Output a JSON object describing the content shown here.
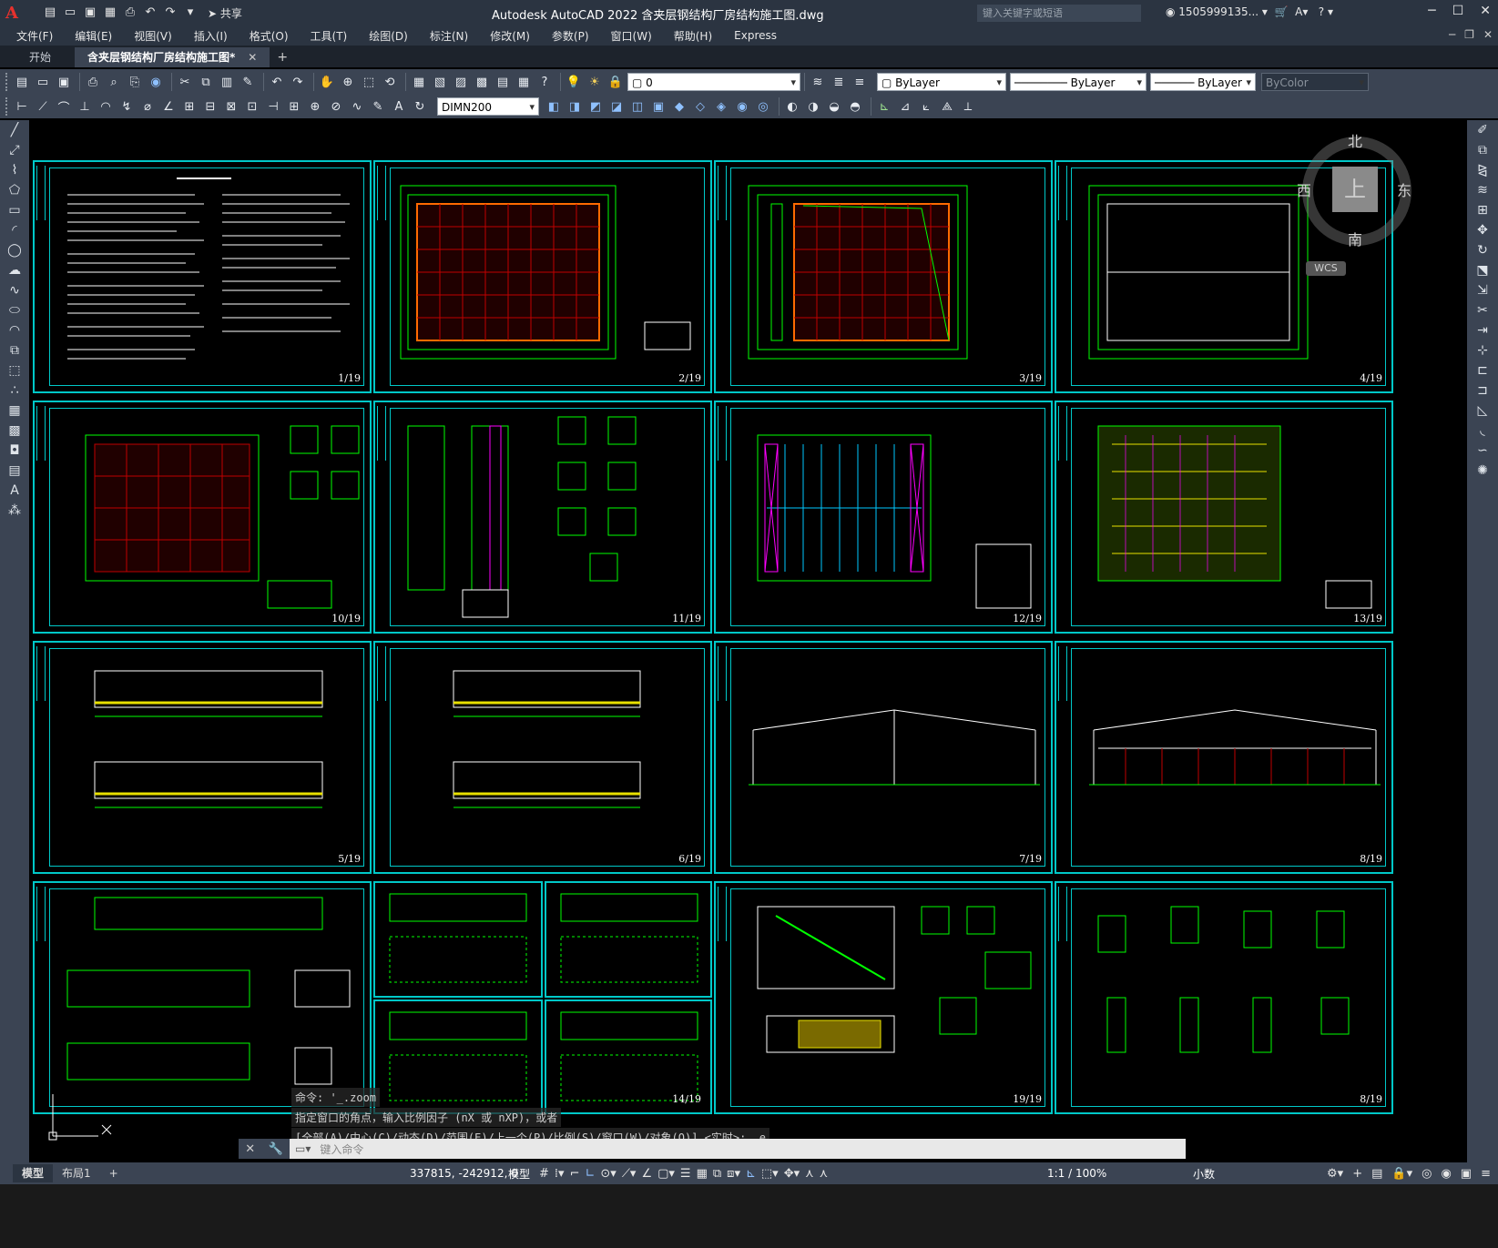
{
  "app": {
    "title": "Autodesk AutoCAD 2022    含夹层钢结构厂房结构施工图.dwg",
    "logo": "A",
    "share_label": "共享",
    "search_placeholder": "键入关键字或短语",
    "user": "1505999135..."
  },
  "menu": [
    "文件(F)",
    "编辑(E)",
    "视图(V)",
    "插入(I)",
    "格式(O)",
    "工具(T)",
    "绘图(D)",
    "标注(N)",
    "修改(M)",
    "参数(P)",
    "窗口(W)",
    "帮助(H)",
    "Express"
  ],
  "tabs": {
    "start": "开始",
    "active": "含夹层钢结构厂房结构施工图*"
  },
  "toolbar": {
    "layer_value": "0",
    "color_value": "ByLayer",
    "linetype_value": "ByLayer",
    "lineweight_value": "ByLayer",
    "plotstyle_value": "ByColor",
    "dimstyle_value": "DIMN200"
  },
  "sheets": [
    "1/19",
    "2/19",
    "3/19",
    "4/19",
    "10/19",
    "11/19",
    "12/19",
    "13/19",
    "5/19",
    "6/19",
    "7/19",
    "8/19",
    "14/19",
    "19/19",
    "8/19"
  ],
  "viewcube": {
    "north": "北",
    "south": "南",
    "east": "东",
    "west": "西",
    "top": "上",
    "wcs": "WCS"
  },
  "command": {
    "history1": "命令: '_.zoom",
    "history2": "指定窗口的角点，输入比例因子 (nX 或 nXP)，或者",
    "history3": "[全部(A)/中心(C)/动态(D)/范围(E)/上一个(P)/比例(S)/窗口(W)/对象(O)] <实时>: _e",
    "placeholder": "键入命令"
  },
  "status": {
    "layout_model": "模型",
    "layout_1": "布局1",
    "coords": "337815, -242912, 0",
    "space": "模型",
    "scale": "1:1 / 100%",
    "units": "小数"
  },
  "colors": {
    "background": "#000000",
    "frame": "#00c8c8",
    "grid": "#00ff00",
    "accent_red": "#c00000",
    "chrome": "#3b4453"
  }
}
